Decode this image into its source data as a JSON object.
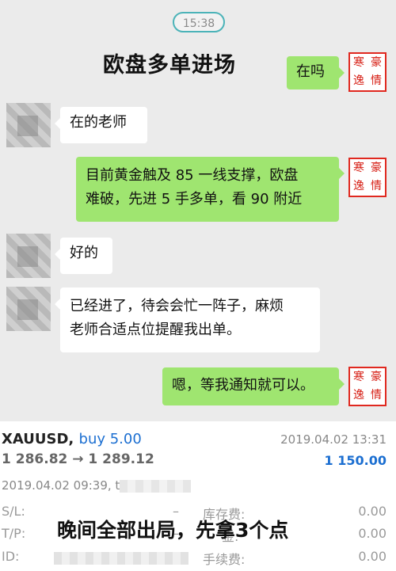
{
  "chat": {
    "timestamp": "15:38",
    "overlay_title": "欧盘多单进场",
    "avatar_chars": [
      "寒",
      "豪",
      "逸",
      "情"
    ],
    "messages": [
      {
        "side": "right",
        "text": "在吗"
      },
      {
        "side": "left",
        "text": "在的老师"
      },
      {
        "side": "right",
        "lines": [
          "目前黄金触及 85 一线支撑，欧盘",
          "难破，先进 5 手多单，看 90 附近"
        ]
      },
      {
        "side": "left",
        "text": "好的"
      },
      {
        "side": "left",
        "lines": [
          "已经进了，待会会忙一阵子，麻烦",
          "老师合适点位提醒我出单。"
        ]
      },
      {
        "side": "right",
        "text": "嗯，等我通知就可以。"
      }
    ]
  },
  "trade": {
    "symbol": "XAUUSD,",
    "side": "buy 5.00",
    "close_time": "2019.04.02 13:31",
    "prices": "1 286.82 → 1 289.12",
    "profit": "1 150.00",
    "open_time": "2019.04.02 09:39, t",
    "sl_label": "S/L:",
    "sl_value": "–",
    "swap_label": "库存费:",
    "swap_value": "0.00",
    "tp_label": "T/P:",
    "tp_value": "–",
    "tax_label": "金:",
    "tax_value": "0.00",
    "id_label": "ID:",
    "commission_label": "手续费:",
    "commission_value": "0.00"
  },
  "overlay_bottom": "晚间全部出局，先拿3个点"
}
